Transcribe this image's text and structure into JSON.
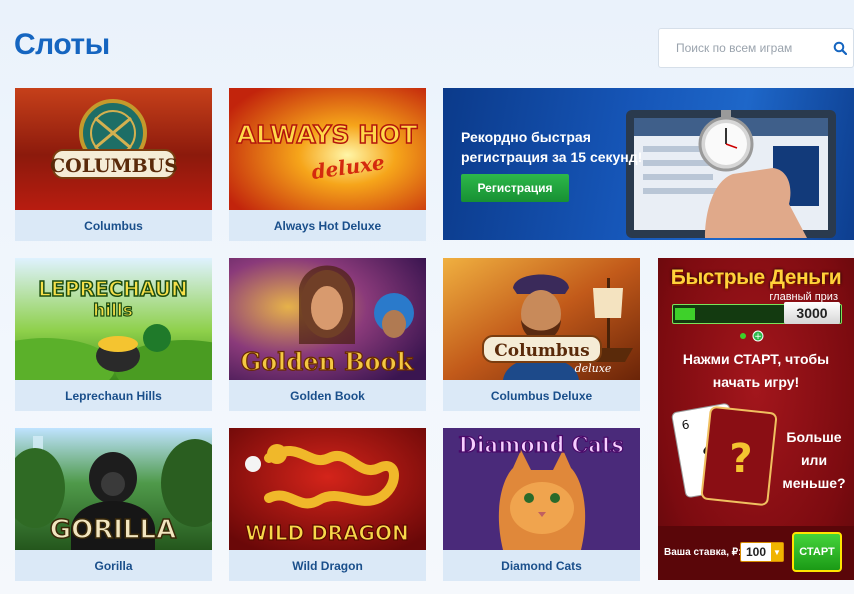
{
  "page": {
    "title": "Слоты"
  },
  "search": {
    "placeholder": "Поиск по всем играм",
    "icon": "search-icon"
  },
  "games": [
    {
      "name": "Columbus",
      "logo": "COLUMBUS"
    },
    {
      "name": "Always Hot Deluxe",
      "logo": "ALWAYS HOT",
      "logo_sub": "deluxe"
    },
    {
      "name": "Leprechaun Hills",
      "logo": "LEPRECHAUN",
      "logo_sub": "hills"
    },
    {
      "name": "Golden Book",
      "logo": "Golden Book"
    },
    {
      "name": "Columbus Deluxe",
      "logo": "Columbus",
      "logo_sub": "deluxe"
    },
    {
      "name": "Gorilla",
      "logo": "GORILLA"
    },
    {
      "name": "Wild Dragon",
      "logo": "WILD DRAGON"
    },
    {
      "name": "Diamond Cats",
      "logo": "Diamond Cats"
    }
  ],
  "registration_banner": {
    "text": "Рекордно быстрая регистрация за 15 секунд!",
    "button": "Регистрация"
  },
  "promo": {
    "title": "Быстрые Деньги",
    "prize_label": "главный приз",
    "prize": "3000",
    "progress": 0.12,
    "cta": "Нажми СТАРТ, чтобы начать игру!",
    "question": "Больше или меньше?",
    "card_mark": "?",
    "stake_label": "Ваша ставка, ₽:",
    "stake": "100",
    "start": "СТАРТ"
  },
  "colors": {
    "accent": "#1565c0",
    "game_name": "#1a4f8b",
    "card_bg": "#dbe9f7",
    "green": "#2db84a",
    "promo_red": "#7c0b10",
    "gold": "#ffd23a"
  }
}
